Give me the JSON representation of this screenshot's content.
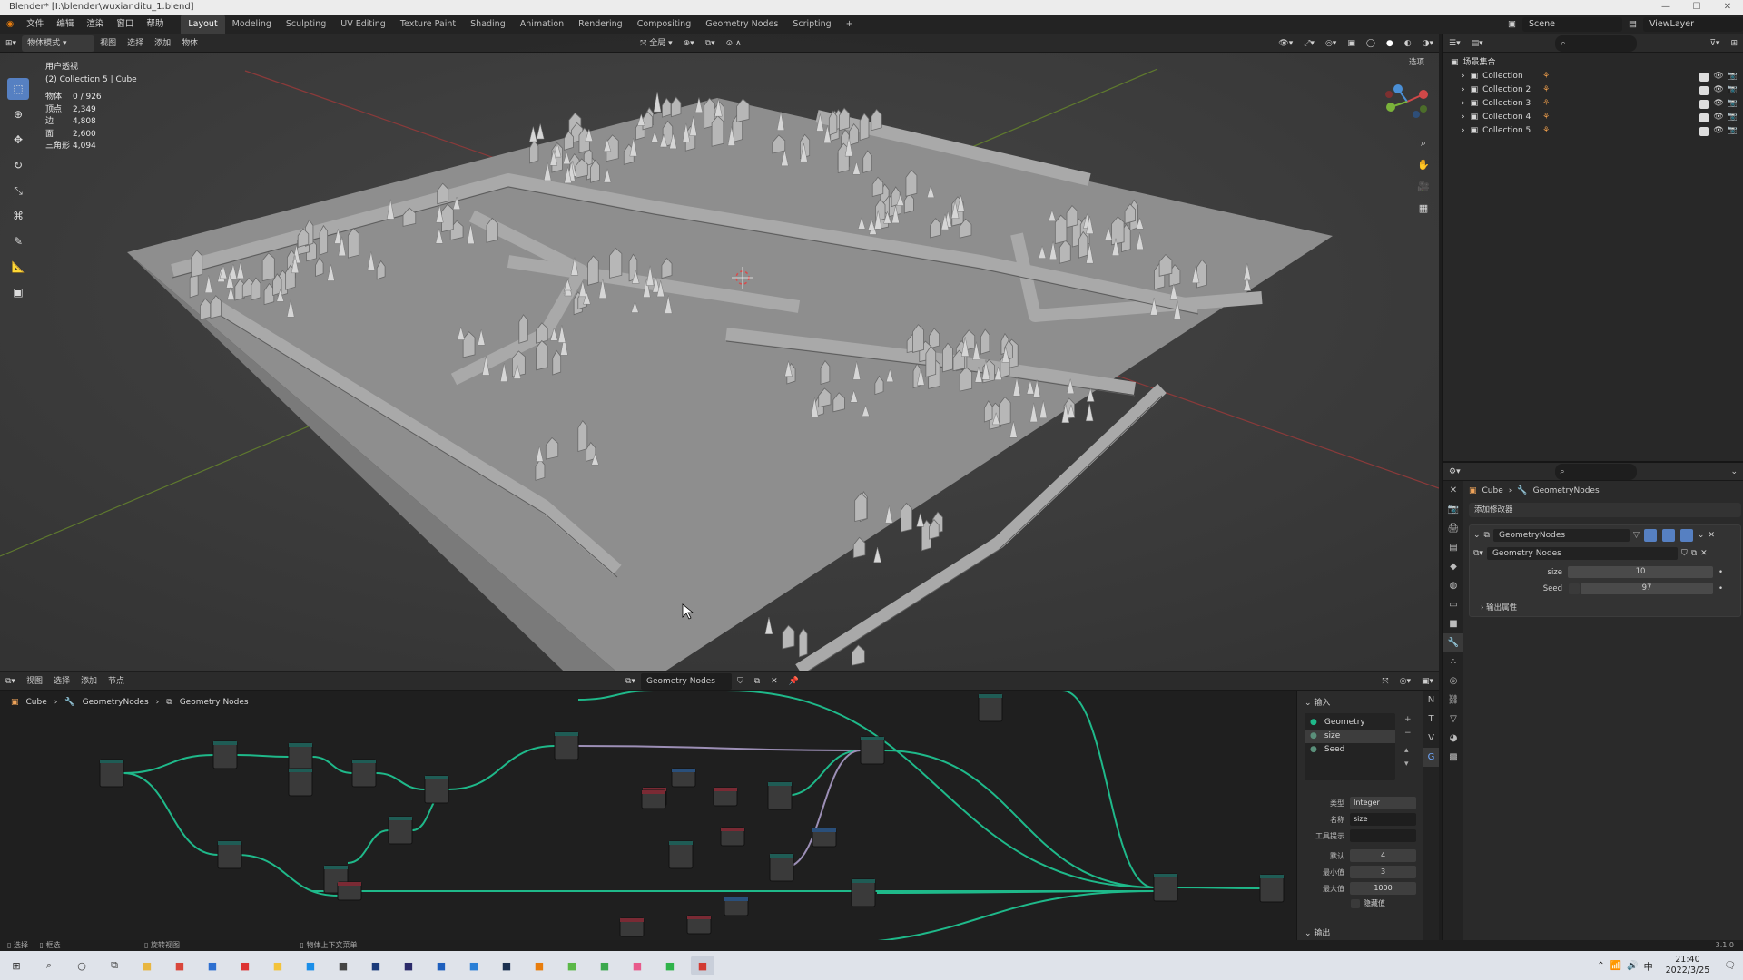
{
  "window": {
    "title": "Blender* [I:\\blender\\wuxianditu_1.blend]",
    "controls": [
      "—",
      "☐",
      "✕"
    ]
  },
  "menu": {
    "items": [
      "文件",
      "编辑",
      "渲染",
      "窗口",
      "帮助"
    ],
    "workspaces": [
      "Layout",
      "Modeling",
      "Sculpting",
      "UV Editing",
      "Texture Paint",
      "Shading",
      "Animation",
      "Rendering",
      "Compositing",
      "Geometry Nodes",
      "Scripting"
    ],
    "active_workspace": "Layout",
    "scene_label": "Scene",
    "viewlayer_label": "ViewLayer"
  },
  "viewport": {
    "mode": "物体模式",
    "menus": [
      "视图",
      "选择",
      "添加",
      "物体"
    ],
    "transform_orientation": "全局",
    "view_name": "用户透视",
    "collection_info": "(2) Collection 5 | Cube",
    "overlay_label": "选项",
    "stats": [
      {
        "label": "物体",
        "value": "0 / 926"
      },
      {
        "label": "顶点",
        "value": "2,349"
      },
      {
        "label": "边",
        "value": "4,808"
      },
      {
        "label": "面",
        "value": "2,600"
      },
      {
        "label": "三角形",
        "value": "4,094"
      }
    ],
    "tools": [
      "select-box",
      "cursor",
      "move",
      "rotate",
      "scale",
      "transform",
      "annotate",
      "measure",
      "add-cube"
    ],
    "active_tool": "select-box",
    "gizmo_axes": [
      "X",
      "Y",
      "Z"
    ]
  },
  "outliner": {
    "root": "场景集合",
    "collections": [
      "Collection",
      "Collection 2",
      "Collection 3",
      "Collection 4",
      "Collection 5"
    ]
  },
  "properties": {
    "breadcrumb": [
      "Cube",
      "GeometryNodes"
    ],
    "add_modifier": "添加修改器",
    "modifier_name": "GeometryNodes",
    "node_group": "Geometry Nodes",
    "inputs": [
      {
        "label": "size",
        "value": "10"
      },
      {
        "label": "Seed",
        "value": "97"
      }
    ],
    "output_attrs": "输出属性"
  },
  "node_editor": {
    "menus": [
      "视图",
      "选择",
      "添加",
      "节点"
    ],
    "node_tree": "Geometry Nodes",
    "breadcrumb": [
      "Cube",
      "GeometryNodes",
      "Geometry Nodes"
    ],
    "sidebar": {
      "inputs_header": "输入",
      "sockets": [
        "Geometry",
        "size",
        "Seed"
      ],
      "active_socket": "size",
      "type_label": "类型",
      "type_value": "Integer",
      "name_label": "名称",
      "name_value": "size",
      "tooltip_label": "工具提示",
      "tooltip_value": "",
      "default_label": "默认",
      "default_value": "4",
      "min_label": "最小值",
      "min_value": "3",
      "max_label": "最大值",
      "max_value": "1000",
      "hide_value_label": "隐藏值",
      "outputs_header": "输出"
    }
  },
  "statusbar": {
    "items": [
      "选择",
      "框选",
      "旋转视图",
      "物体上下文菜单"
    ],
    "version": "3.1.0"
  },
  "taskbar": {
    "apps": [
      "start",
      "search",
      "cortana",
      "taskview",
      "explorer",
      "chrome",
      "app",
      "netease",
      "notes",
      "skype",
      "unity",
      "photoshop",
      "app2",
      "mail",
      "vscode",
      "steam",
      "blender",
      "game",
      "app3",
      "app4",
      "wechat",
      "app5"
    ],
    "tray_lang": "中",
    "time": "21:40",
    "date": "2022/3/25"
  },
  "colors": {
    "accent": "#5680c2",
    "node_link": "#1fb98a",
    "node_geo": "#1f5c55",
    "node_red": "#7a2a34",
    "node_blue": "#2a4f7a"
  }
}
